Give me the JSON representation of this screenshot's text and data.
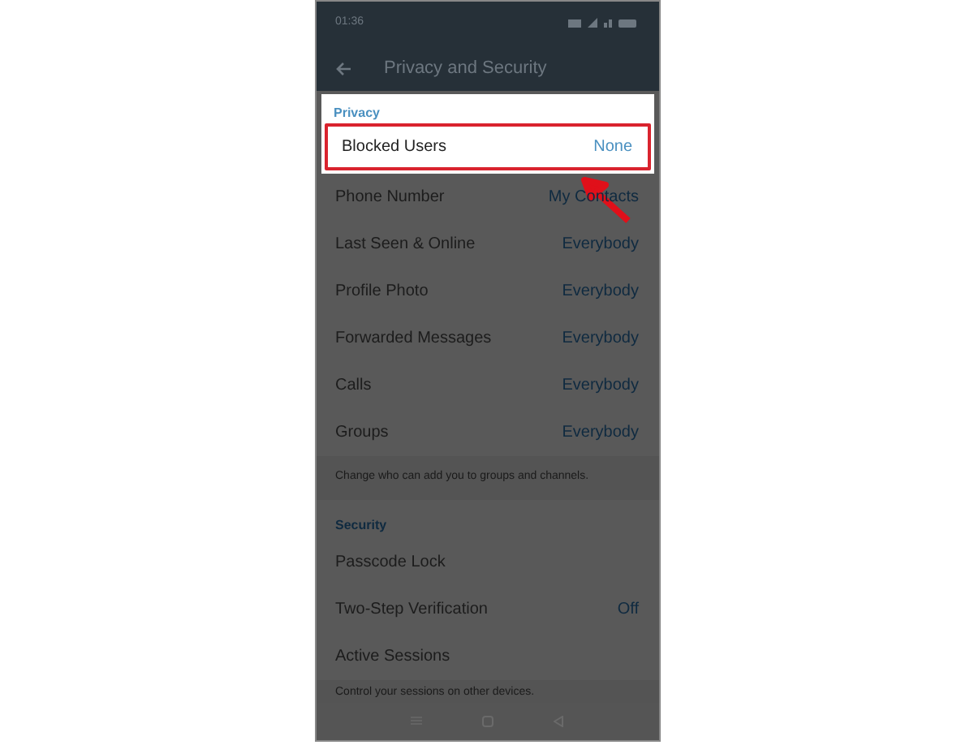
{
  "status_bar": {
    "time": "01:36"
  },
  "header": {
    "title": "Privacy and Security"
  },
  "privacy": {
    "title": "Privacy",
    "rows": [
      {
        "label": "Blocked Users",
        "value": "None",
        "highlighted": true
      },
      {
        "label": "Phone Number",
        "value": "My Contacts",
        "highlighted": false
      },
      {
        "label": "Last Seen & Online",
        "value": "Everybody",
        "highlighted": false
      },
      {
        "label": "Profile Photo",
        "value": "Everybody",
        "highlighted": false
      },
      {
        "label": "Forwarded Messages",
        "value": "Everybody",
        "highlighted": false
      },
      {
        "label": "Calls",
        "value": "Everybody",
        "highlighted": false
      },
      {
        "label": "Groups",
        "value": "Everybody",
        "highlighted": false
      }
    ],
    "hint": "Change who can add you to groups and channels."
  },
  "security": {
    "title": "Security",
    "rows": [
      {
        "label": "Passcode Lock",
        "highlighted": false
      },
      {
        "label": "Two-Step Verification",
        "value": "Off",
        "highlighted": false
      },
      {
        "label": "Active Sessions",
        "highlighted": false
      }
    ],
    "hint": "Control your sessions on other devices."
  }
}
